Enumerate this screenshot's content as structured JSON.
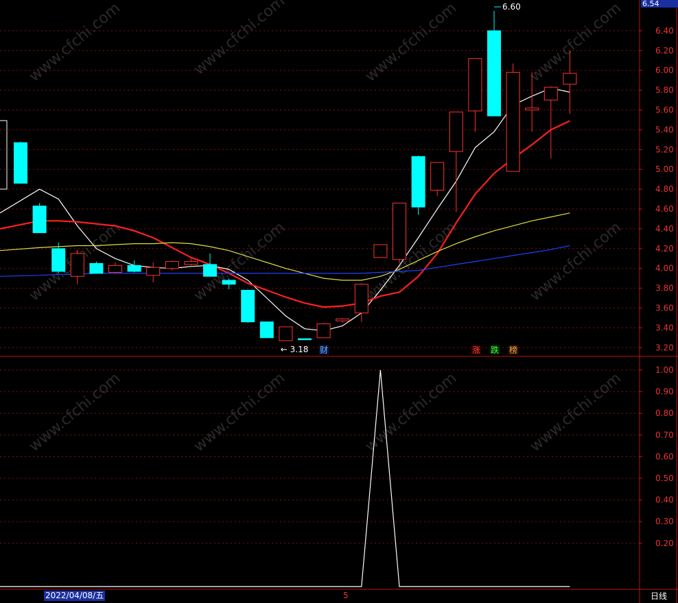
{
  "price_tag": "6.54",
  "date_label": "2022/04/08/五",
  "period_label": "日线",
  "cursor_label": "5",
  "markers": {
    "cai": "财",
    "zhang": "涨",
    "die": "跌",
    "bang": "榜"
  },
  "watermark": "www.cfchi.com",
  "colors": {
    "up": "#ff3232",
    "down": "#00ffff",
    "ma5": "#ffffff",
    "ma10": "#ff2020",
    "ma20": "#e0e040",
    "ma60": "#2040ff",
    "grid": "#8a1010",
    "axis": "#c01010"
  },
  "chart_data": [
    {
      "type": "candlestick",
      "ylim": [
        3.05,
        6.6
      ],
      "yticks": [
        "6.40",
        "6.20",
        "6.00",
        "5.80",
        "5.60",
        "5.40",
        "5.20",
        "5.00",
        "4.80",
        "4.60",
        "4.40",
        "4.20",
        "4.00",
        "3.80",
        "3.60",
        "3.40",
        "3.20"
      ],
      "annotations": {
        "high": "6.60",
        "low": "3.18"
      },
      "candles": [
        {
          "o": 4.86,
          "h": 5.28,
          "l": 4.86,
          "c": 5.27,
          "d": "down"
        },
        {
          "o": 4.63,
          "h": 4.66,
          "l": 4.36,
          "c": 4.36,
          "d": "down"
        },
        {
          "o": 4.2,
          "h": 4.26,
          "l": 3.95,
          "c": 3.97,
          "d": "down"
        },
        {
          "o": 3.92,
          "h": 4.19,
          "l": 3.84,
          "c": 4.15,
          "d": "up"
        },
        {
          "o": 4.05,
          "h": 4.07,
          "l": 3.95,
          "c": 3.95,
          "d": "down"
        },
        {
          "o": 3.96,
          "h": 4.06,
          "l": 3.95,
          "c": 4.03,
          "d": "up"
        },
        {
          "o": 4.03,
          "h": 4.08,
          "l": 3.96,
          "c": 3.97,
          "d": "down"
        },
        {
          "o": 3.93,
          "h": 4.06,
          "l": 3.86,
          "c": 4.01,
          "d": "up"
        },
        {
          "o": 4.0,
          "h": 4.08,
          "l": 3.98,
          "c": 4.07,
          "d": "up"
        },
        {
          "o": 4.04,
          "h": 4.1,
          "l": 4.03,
          "c": 4.07,
          "d": "up"
        },
        {
          "o": 4.04,
          "h": 4.15,
          "l": 3.92,
          "c": 3.92,
          "d": "down"
        },
        {
          "o": 3.88,
          "h": 3.9,
          "l": 3.79,
          "c": 3.84,
          "d": "down"
        },
        {
          "o": 3.78,
          "h": 3.78,
          "l": 3.45,
          "c": 3.46,
          "d": "down"
        },
        {
          "o": 3.46,
          "h": 3.46,
          "l": 3.3,
          "c": 3.3,
          "d": "down"
        },
        {
          "o": 3.27,
          "h": 3.41,
          "l": 3.27,
          "c": 3.41,
          "d": "up"
        },
        {
          "o": 3.29,
          "h": 3.29,
          "l": 3.29,
          "c": 3.29,
          "d": "down"
        },
        {
          "o": 3.3,
          "h": 3.45,
          "l": 3.3,
          "c": 3.44,
          "d": "up"
        },
        {
          "o": 3.47,
          "h": 3.5,
          "l": 3.45,
          "c": 3.49,
          "d": "up"
        },
        {
          "o": 3.55,
          "h": 3.85,
          "l": 3.46,
          "c": 3.84,
          "d": "up"
        },
        {
          "o": 4.11,
          "h": 4.24,
          "l": 4.11,
          "c": 4.24,
          "d": "up"
        },
        {
          "o": 4.09,
          "h": 4.66,
          "l": 4.05,
          "c": 4.66,
          "d": "up"
        },
        {
          "o": 5.13,
          "h": 5.14,
          "l": 4.54,
          "c": 4.62,
          "d": "down"
        },
        {
          "o": 4.79,
          "h": 5.07,
          "l": 4.73,
          "c": 5.07,
          "d": "up"
        },
        {
          "o": 5.18,
          "h": 5.58,
          "l": 4.57,
          "c": 5.58,
          "d": "up"
        },
        {
          "o": 5.59,
          "h": 6.12,
          "l": 5.38,
          "c": 6.12,
          "d": "up"
        },
        {
          "o": 5.54,
          "h": 6.6,
          "l": 5.54,
          "c": 6.4,
          "d": "down"
        },
        {
          "o": 4.98,
          "h": 6.07,
          "l": 4.98,
          "c": 5.98,
          "d": "up"
        },
        {
          "o": 5.6,
          "h": 5.98,
          "l": 5.38,
          "c": 5.62,
          "d": "up"
        },
        {
          "o": 5.7,
          "h": 5.84,
          "l": 5.11,
          "c": 5.83,
          "d": "up"
        },
        {
          "o": 5.86,
          "h": 6.2,
          "l": 5.56,
          "c": 5.97,
          "d": "up"
        }
      ],
      "ma_lines": {
        "ma5": [
          4.56,
          4.8,
          4.7,
          4.43,
          4.2,
          4.1,
          4.03,
          4.01,
          4.0,
          4.02,
          4.03,
          3.99,
          3.88,
          3.7,
          3.52,
          3.39,
          3.37,
          3.42,
          3.55,
          3.78,
          4.03,
          4.31,
          4.6,
          4.88,
          5.22,
          5.38,
          5.65,
          5.74,
          5.82,
          5.78
        ],
        "ma10": [
          4.4,
          4.48,
          4.48,
          4.47,
          4.45,
          4.43,
          4.38,
          4.31,
          4.21,
          4.11,
          4.04,
          3.95,
          3.85,
          3.78,
          3.71,
          3.65,
          3.61,
          3.62,
          3.65,
          3.72,
          3.76,
          3.92,
          4.15,
          4.46,
          4.75,
          4.96,
          5.11,
          5.25,
          5.4,
          5.49
        ],
        "ma20": [
          4.18,
          4.21,
          4.22,
          4.23,
          4.23,
          4.24,
          4.25,
          4.25,
          4.26,
          4.25,
          4.22,
          4.18,
          4.12,
          4.06,
          4.0,
          3.95,
          3.9,
          3.88,
          3.88,
          3.92,
          3.99,
          4.08,
          4.17,
          4.25,
          4.32,
          4.38,
          4.43,
          4.48,
          4.52,
          4.56
        ],
        "ma60": [
          3.92,
          3.93,
          3.94,
          3.94,
          3.95,
          3.95,
          3.95,
          3.95,
          3.95,
          3.95,
          3.95,
          3.95,
          3.95,
          3.95,
          3.95,
          3.95,
          3.95,
          3.95,
          3.95,
          3.96,
          3.97,
          3.98,
          4.01,
          4.04,
          4.07,
          4.1,
          4.13,
          4.16,
          4.19,
          4.23
        ]
      }
    },
    {
      "type": "line",
      "ylim": [
        0,
        1.05
      ],
      "yticks": [
        "1.00",
        "0.90",
        "0.80",
        "0.70",
        "0.60",
        "0.50",
        "0.40",
        "0.30",
        "0.20"
      ],
      "values": [
        0,
        0,
        0,
        0,
        0,
        0,
        0,
        0,
        0,
        0,
        0,
        0,
        0,
        0,
        0,
        0,
        0,
        0,
        0,
        1,
        0,
        0,
        0,
        0,
        0,
        0,
        0,
        0,
        0,
        0
      ]
    }
  ]
}
